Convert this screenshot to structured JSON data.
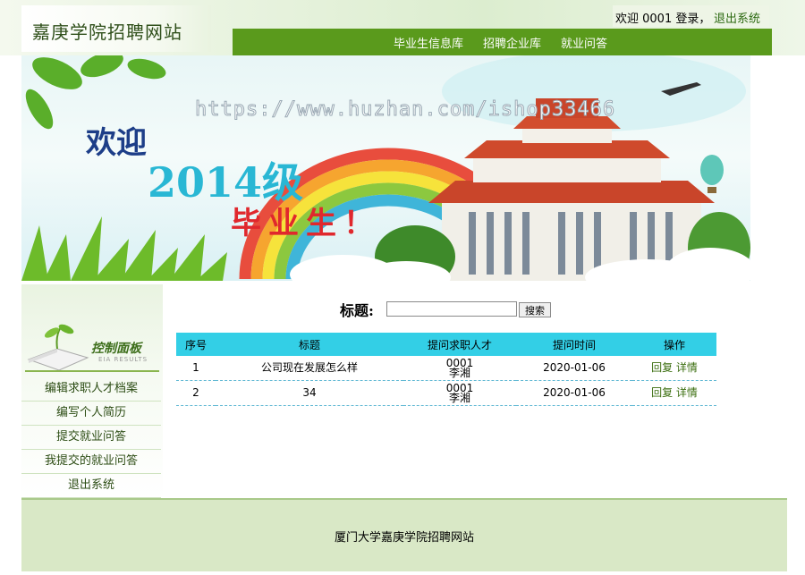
{
  "header": {
    "site_title": "嘉庚学院招聘网站",
    "welcome_text": "欢迎 0001 登录，",
    "logout_label": "退出系统",
    "nav": [
      "毕业生信息库",
      "招聘企业库",
      "就业问答"
    ]
  },
  "banner": {
    "watermark": "https://www.huzhan.com/ishop33466",
    "line1": "欢迎",
    "line2": "2014级",
    "line3": "毕业生！"
  },
  "sidebar": {
    "panel_title": "控制面板",
    "panel_subtitle": "EIA RESULTS",
    "items": [
      "编辑求职人才档案",
      "编写个人简历",
      "提交就业问答",
      "我提交的就业问答",
      "退出系统"
    ]
  },
  "search": {
    "label": "标题:",
    "value": "",
    "button": "搜索"
  },
  "table": {
    "headers": [
      "序号",
      "标题",
      "提问求职人才",
      "提问时间",
      "操作"
    ],
    "rows": [
      {
        "no": "1",
        "title": "公司现在发展怎么样",
        "asker_id": "0001",
        "asker_name": "李湘",
        "time": "2020-01-06",
        "reply": "回复",
        "detail": "详情"
      },
      {
        "no": "2",
        "title": "34",
        "asker_id": "0001",
        "asker_name": "李湘",
        "time": "2020-01-06",
        "reply": "回复",
        "detail": "详情"
      }
    ]
  },
  "footer": {
    "text": "厦门大学嘉庚学院招聘网站"
  },
  "colors": {
    "nav_bg": "#5a9a1c",
    "table_header": "#33cfe6",
    "footer_bg": "#d9e8c6"
  }
}
